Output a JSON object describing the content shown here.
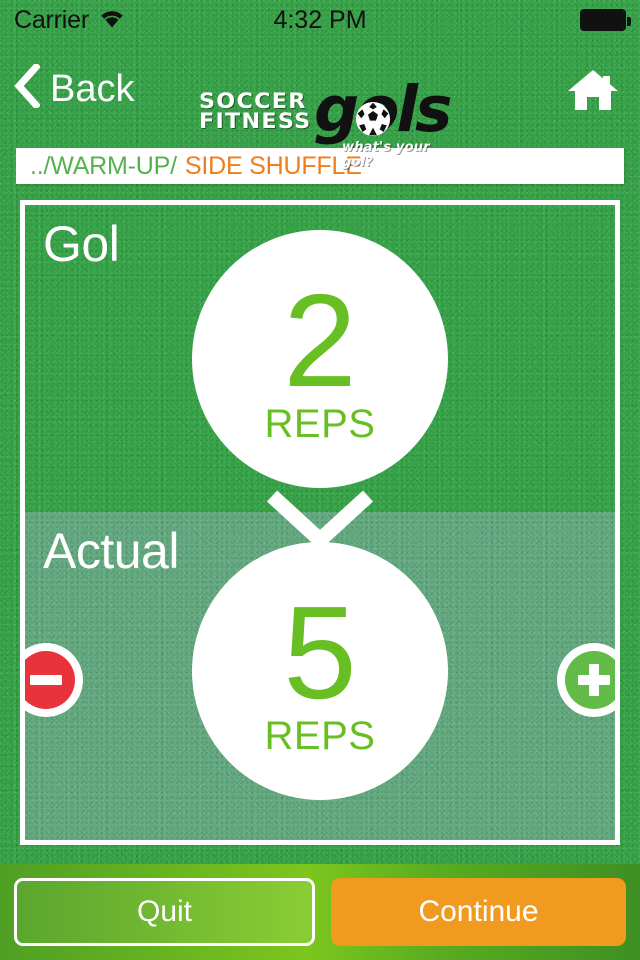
{
  "status_bar": {
    "carrier": "Carrier",
    "wifi_icon": "wifi-icon",
    "time": "4:32 PM",
    "battery_icon": "battery-full-icon"
  },
  "navbar": {
    "back_label": "Back",
    "back_icon": "chevron-left-icon",
    "home_icon": "home-icon",
    "logo": {
      "line1": "SOCCER",
      "line2": "FITNESS",
      "wordmark": "gols",
      "ball_icon": "soccer-ball-icon",
      "tagline": "what's your gol?"
    }
  },
  "breadcrumb": {
    "path": "../WARM-UP/",
    "current": "SIDE SHUFFLE"
  },
  "exercise": {
    "goal": {
      "label": "Gol",
      "value": "2",
      "unit": "REPS"
    },
    "arrow_icon": "chevron-down-icon",
    "actual": {
      "label": "Actual",
      "value": "5",
      "unit": "REPS",
      "decrement_icon": "minus-circle-icon",
      "increment_icon": "plus-circle-icon"
    }
  },
  "footer": {
    "quit_label": "Quit",
    "continue_label": "Continue"
  },
  "colors": {
    "field_green": "#35a247",
    "actual_green": "#61a87e",
    "accent_green": "#68bf24",
    "breadcrumb_path": "#55b24e",
    "breadcrumb_current": "#f07d1a",
    "continue_orange": "#f09a20",
    "minus_red": "#e8333a",
    "plus_green": "#62bb46"
  }
}
